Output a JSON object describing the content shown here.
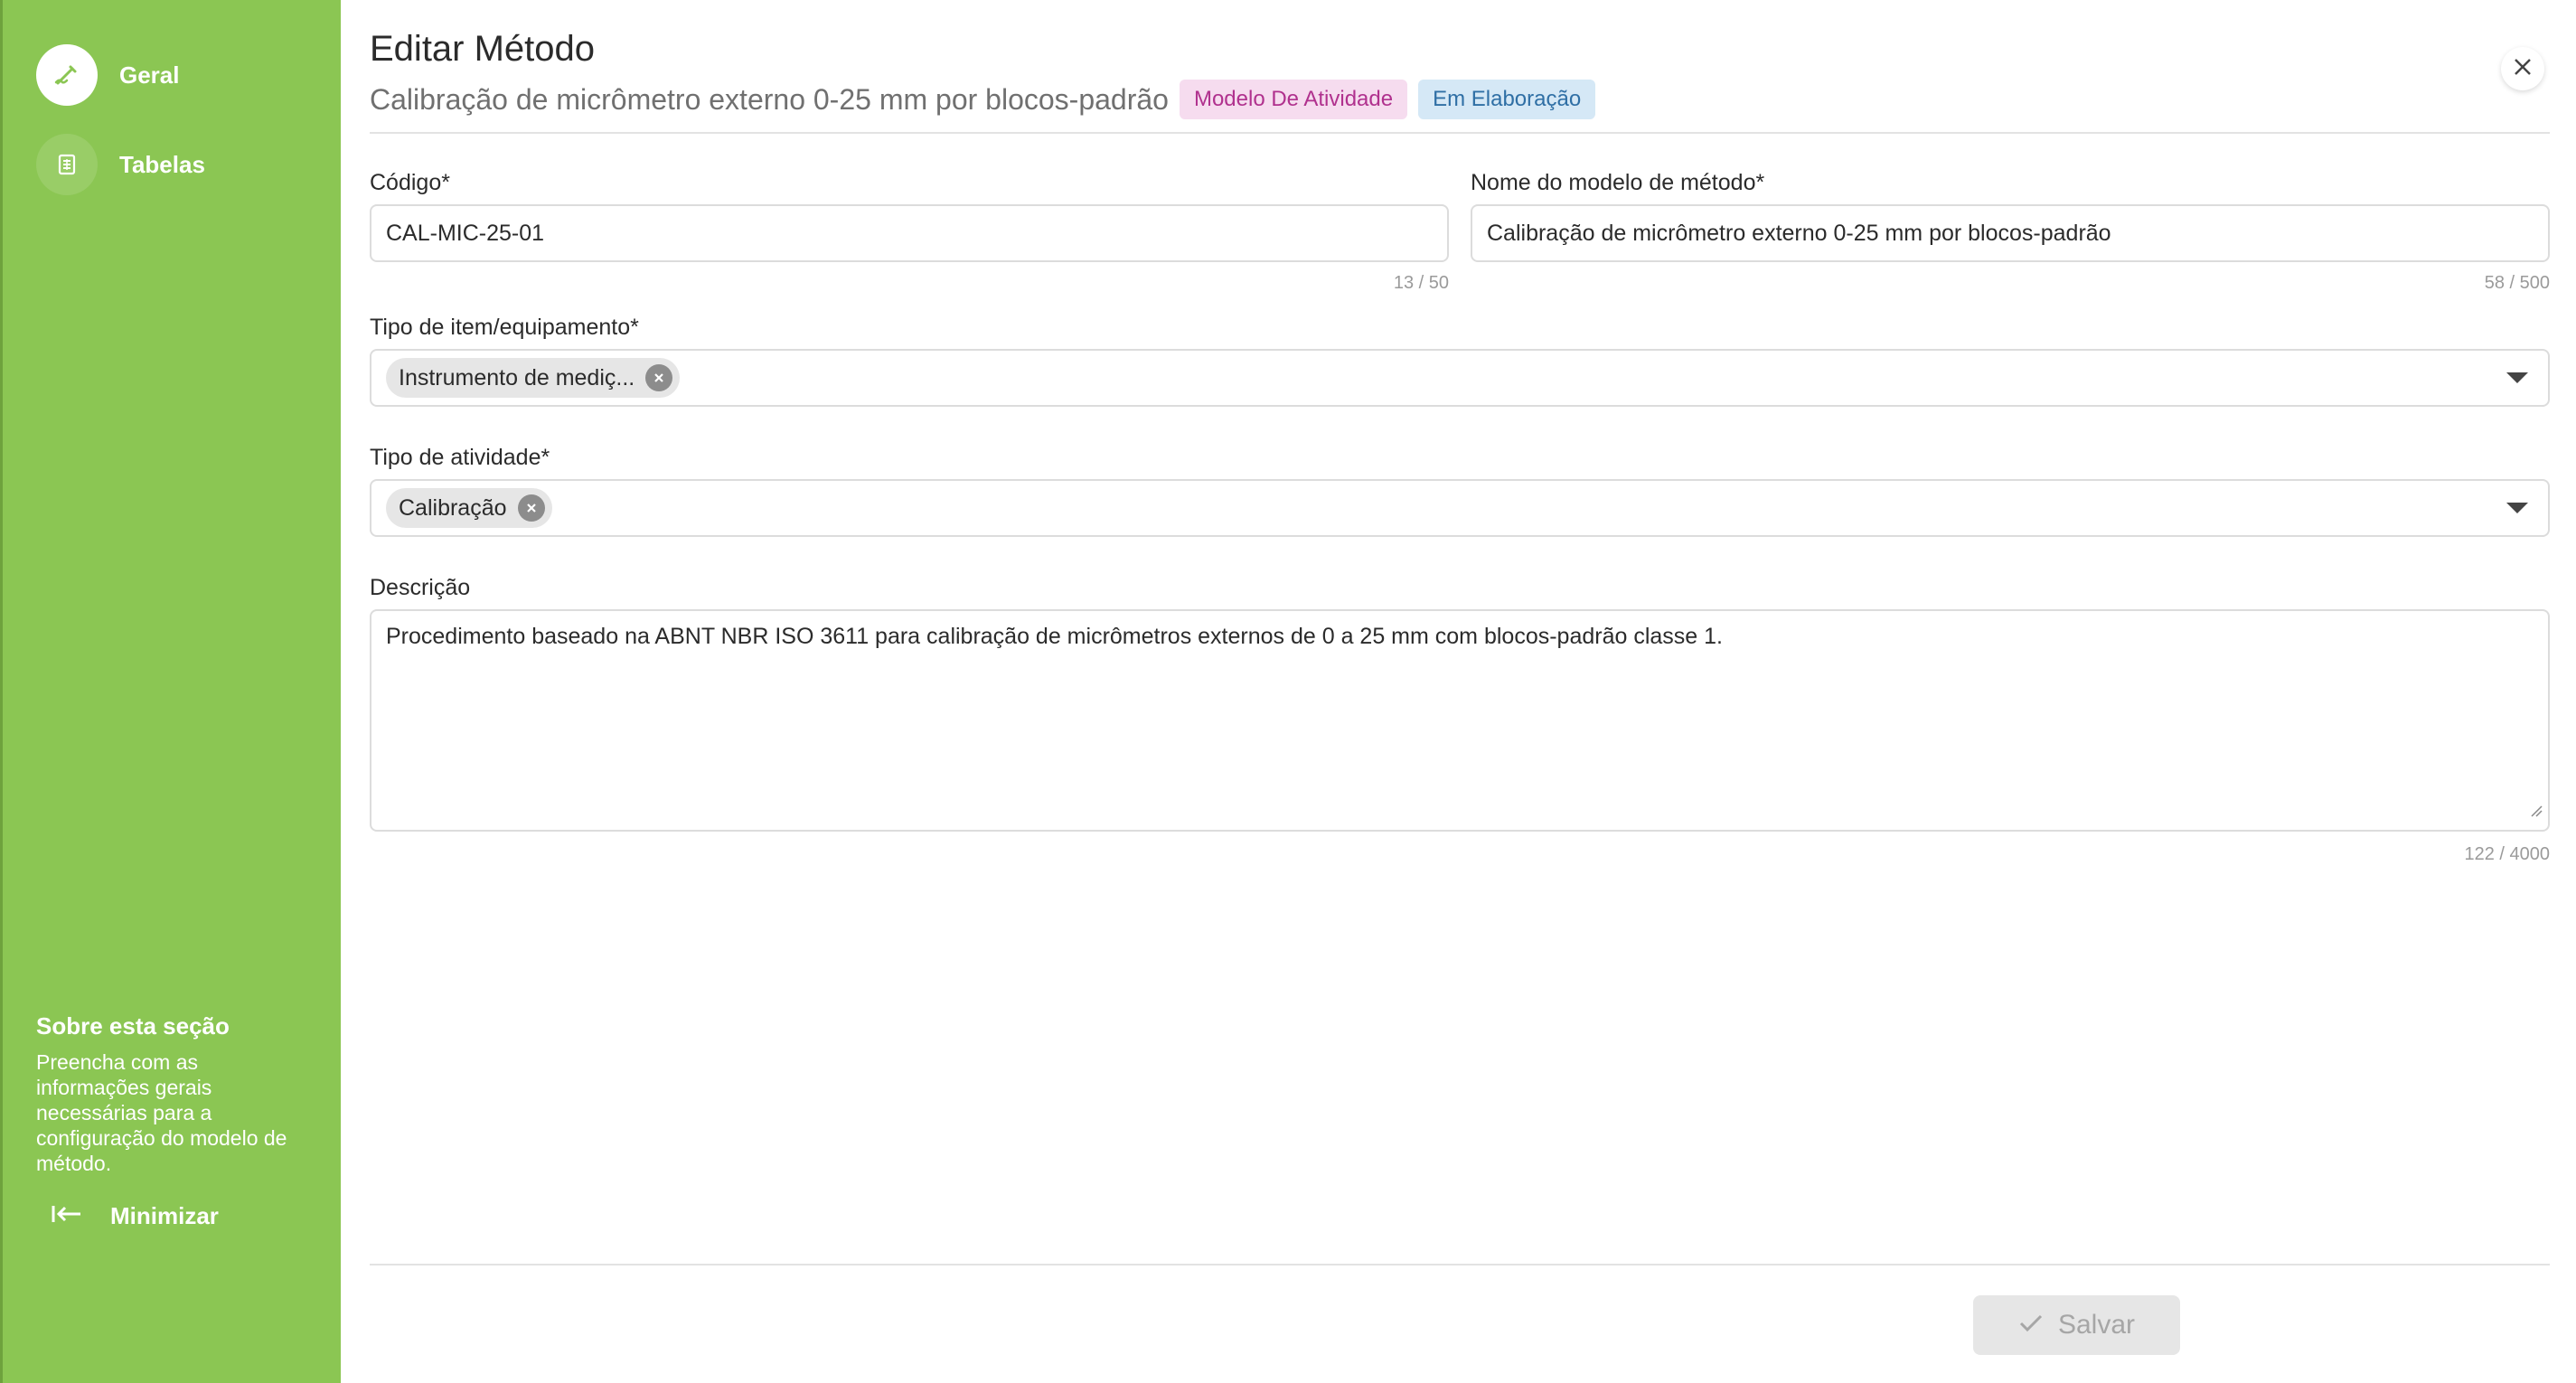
{
  "sidebar": {
    "items": [
      {
        "label": "Geral",
        "icon": "pen-icon",
        "active": true
      },
      {
        "label": "Tabelas",
        "icon": "table-icon",
        "active": false
      }
    ],
    "about": {
      "title": "Sobre esta seção",
      "text": "Preencha com as informações gerais necessárias para a configuração do modelo de método."
    },
    "minimize_label": "Minimizar",
    "color": "#8bc653"
  },
  "header": {
    "title": "Editar Método",
    "subtitle": "Calibração de micrômetro externo 0-25 mm por blocos-padrão",
    "badges": [
      "Modelo De Atividade",
      "Em Elaboração"
    ]
  },
  "form": {
    "codigo": {
      "label": "Código*",
      "value": "CAL-MIC-25-01",
      "counter": "13 / 50"
    },
    "nome": {
      "label": "Nome do modelo de método*",
      "value": "Calibração de micrômetro externo 0-25 mm por blocos-padrão",
      "counter": "58 / 500"
    },
    "tipo_item": {
      "label": "Tipo de item/equipamento*",
      "chips": [
        "Instrumento de mediç..."
      ]
    },
    "tipo_atividade": {
      "label": "Tipo de atividade*",
      "chips": [
        "Calibração"
      ]
    },
    "descricao": {
      "label": "Descrição",
      "value": "Procedimento baseado na ABNT NBR ISO 3611 para calibração de micrômetros externos de 0 a 25 mm com blocos-padrão classe 1.",
      "counter": "122 / 4000"
    }
  },
  "footer": {
    "save_label": "Salvar"
  }
}
